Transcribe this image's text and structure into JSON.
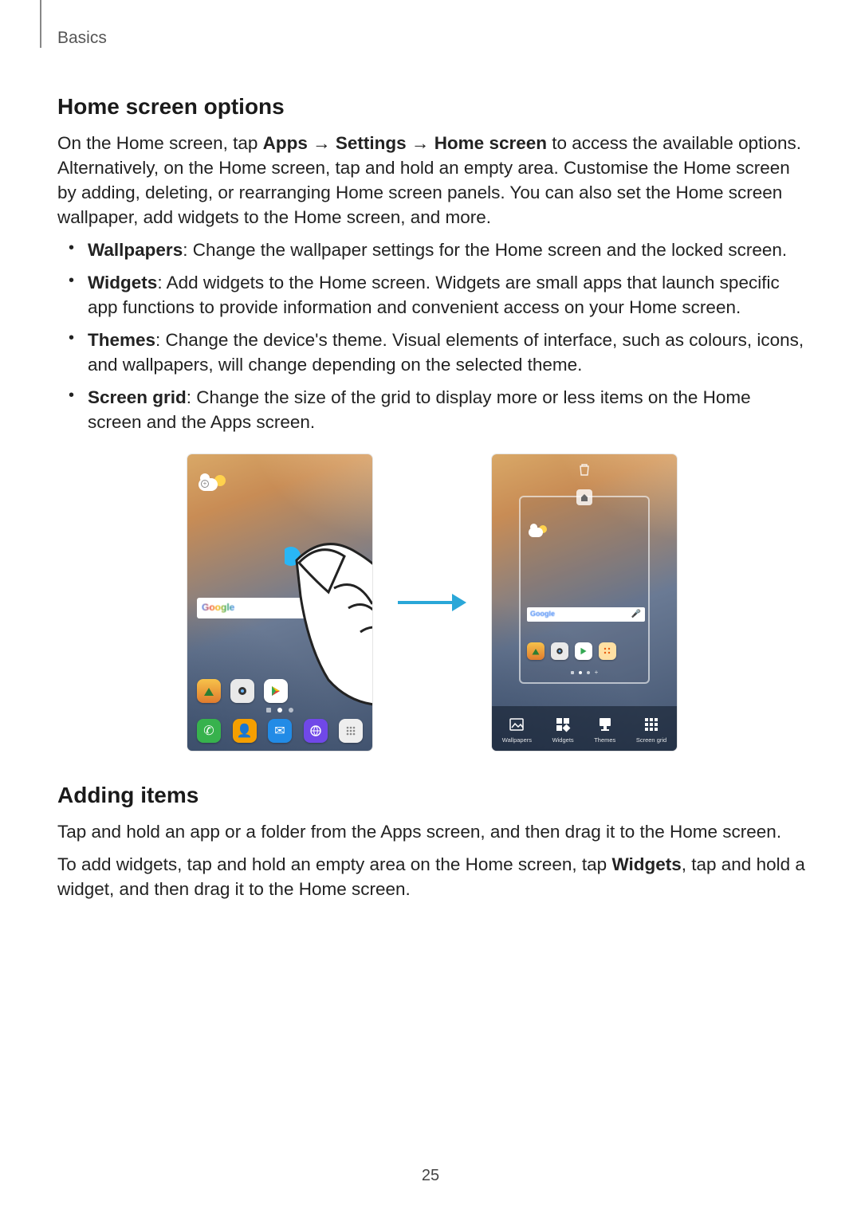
{
  "header": {
    "section": "Basics"
  },
  "section1": {
    "title": "Home screen options",
    "intro_parts": {
      "p1": "On the Home screen, tap ",
      "b1": "Apps",
      "a1": " → ",
      "b2": "Settings",
      "a2": " → ",
      "b3": "Home screen",
      "p2": " to access the available options. Alternatively, on the Home screen, tap and hold an empty area. Customise the Home screen by adding, deleting, or rearranging Home screen panels. You can also set the Home screen wallpaper, add widgets to the Home screen, and more."
    },
    "bullets": [
      {
        "term": "Wallpapers",
        "desc": ": Change the wallpaper settings for the Home screen and the locked screen."
      },
      {
        "term": "Widgets",
        "desc": ": Add widgets to the Home screen. Widgets are small apps that launch specific app functions to provide information and convenient access on your Home screen."
      },
      {
        "term": "Themes",
        "desc": ": Change the device's theme. Visual elements of interface, such as colours, icons, and wallpapers, will change depending on the selected theme."
      },
      {
        "term": "Screen grid",
        "desc": ": Change the size of the grid to display more or less items on the Home screen and the Apps screen."
      }
    ]
  },
  "figure": {
    "left_phone": {
      "search_text": "Google",
      "dock_icons": [
        "gallery",
        "camera",
        "play"
      ],
      "bottom_icons": [
        "phone",
        "contacts",
        "messages",
        "internet",
        "apps"
      ]
    },
    "right_phone": {
      "search_text": "Google",
      "dock_icons": [
        "gallery",
        "camera",
        "play",
        "apps-folder"
      ],
      "bottom_buttons": [
        {
          "icon": "image-icon",
          "label": "Wallpapers"
        },
        {
          "icon": "widgets-icon",
          "label": "Widgets"
        },
        {
          "icon": "themes-icon",
          "label": "Themes"
        },
        {
          "icon": "grid-icon",
          "label": "Screen grid"
        }
      ]
    }
  },
  "section2": {
    "title": "Adding items",
    "p1": "Tap and hold an app or a folder from the Apps screen, and then drag it to the Home screen.",
    "p2_parts": {
      "a": "To add widgets, tap and hold an empty area on the Home screen, tap ",
      "b": "Widgets",
      "c": ", tap and hold a widget, and then drag it to the Home screen."
    }
  },
  "page_number": "25"
}
